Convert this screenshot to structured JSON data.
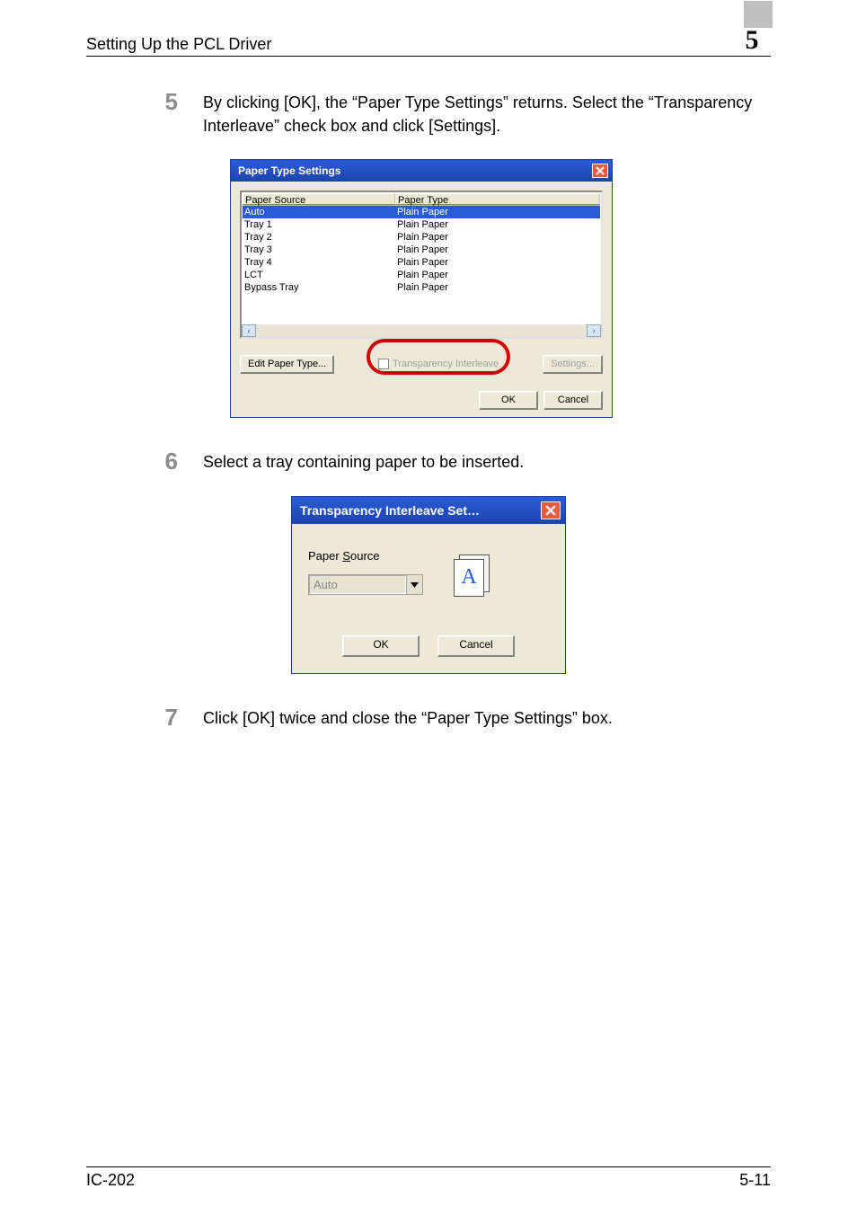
{
  "header": {
    "title": "Setting Up the PCL Driver",
    "chapter": "5"
  },
  "steps": {
    "s5": {
      "num": "5",
      "text": "By clicking [OK], the “Paper Type Settings” returns. Select the “Transparency Interleave” check box and click [Settings]."
    },
    "s6": {
      "num": "6",
      "text": "Select a tray containing paper to be inserted."
    },
    "s7": {
      "num": "7",
      "text": "Click [OK] twice and close the “Paper Type Settings” box."
    }
  },
  "dlg1": {
    "title": "Paper Type Settings",
    "col_source": "Paper Source",
    "col_type": "Paper Type",
    "rows": [
      {
        "source": "Auto",
        "type": "Plain Paper"
      },
      {
        "source": "Tray 1",
        "type": "Plain Paper"
      },
      {
        "source": "Tray 2",
        "type": "Plain Paper"
      },
      {
        "source": "Tray 3",
        "type": "Plain Paper"
      },
      {
        "source": "Tray 4",
        "type": "Plain Paper"
      },
      {
        "source": "LCT",
        "type": "Plain Paper"
      },
      {
        "source": "Bypass Tray",
        "type": "Plain Paper"
      }
    ],
    "edit_btn": "Edit Paper Type...",
    "interleave_label": "Transparency Interleave",
    "settings_btn": "Settings...",
    "ok_btn": "OK",
    "cancel_btn": "Cancel"
  },
  "dlg2": {
    "title": "Transparency Interleave Set…",
    "source_label_pre": "Paper ",
    "source_label_u": "S",
    "source_label_post": "ource",
    "combo_value": "Auto",
    "icon_letter": "A",
    "ok_btn": "OK",
    "cancel_btn": "Cancel"
  },
  "footer": {
    "left": "IC-202",
    "right": "5-11"
  }
}
